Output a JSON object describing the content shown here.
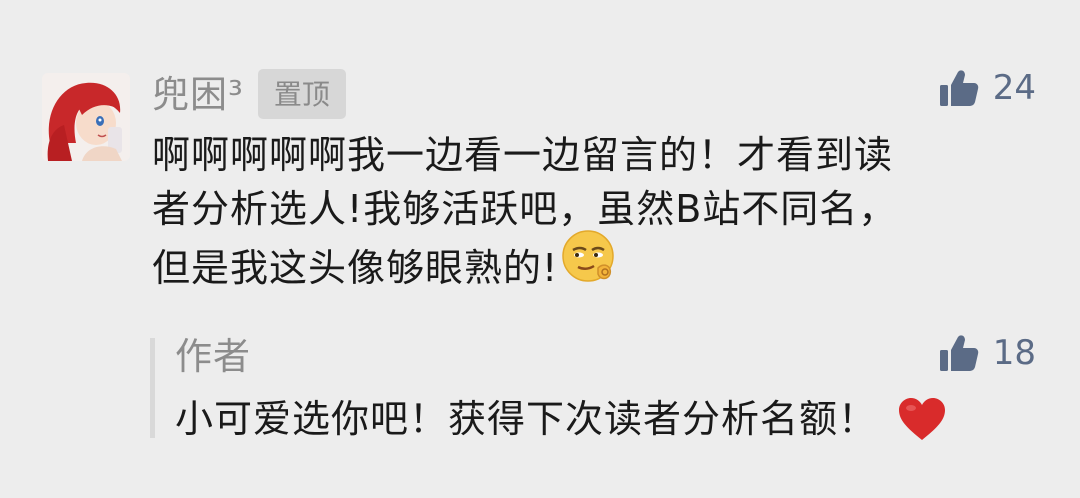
{
  "comment": {
    "author": "兜困³",
    "pinned_badge": "置顶",
    "likes": "24",
    "text_lines": [
      "啊啊啊啊啊我一边看一边留言的！才看到读",
      "者分析选人!我够活跃吧，虽然B站不同名，",
      "但是我这头像够眼熟的!"
    ],
    "avatar_icon": "cartoon-avatar-red-hair",
    "inline_emoji": "smirk-emoji"
  },
  "reply": {
    "author": "作者",
    "likes": "18",
    "text": "小可爱选你吧！获得下次读者分析名额！",
    "trailing_emoji": "red-heart-emoji"
  },
  "colors": {
    "background": "#ededed",
    "like_icon": "#5b6b86",
    "heart": "#d92b2b",
    "badge_bg": "#d7d7d7"
  }
}
